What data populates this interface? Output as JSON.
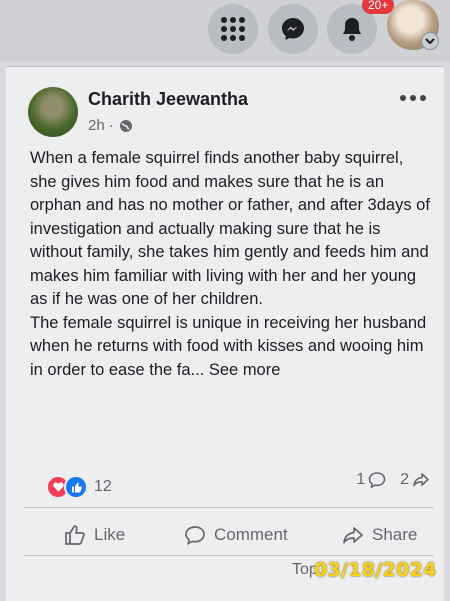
{
  "header": {
    "notification_badge": "20+"
  },
  "post": {
    "author": "Charith Jeewantha",
    "time": "2h ·",
    "paragraphs": [
      "When a female squirrel finds another baby squirrel, she gives him food and makes sure that he is an orphan and has no mother or father, and after 3days of investigation and actually making sure that he is without family, she takes him gently and feeds him and makes him familiar with living with her and her young as if he was one of her children.",
      "The female squirrel is unique in receiving her husband when he returns with food with kisses and wooing him in order to ease the fa..."
    ],
    "see_more": "See more",
    "reaction_count": "12",
    "comment_count": "1",
    "share_count": "2"
  },
  "actions": {
    "like": "Like",
    "comment": "Comment",
    "share": "Share"
  },
  "footer": {
    "partial_text": "Top"
  },
  "overlay": {
    "date_stamp": "03/18/2024"
  },
  "colors": {
    "love": "#f33e58",
    "like": "#1877f2",
    "badge": "#e4383e",
    "date_stamp": "#f6d21b"
  }
}
